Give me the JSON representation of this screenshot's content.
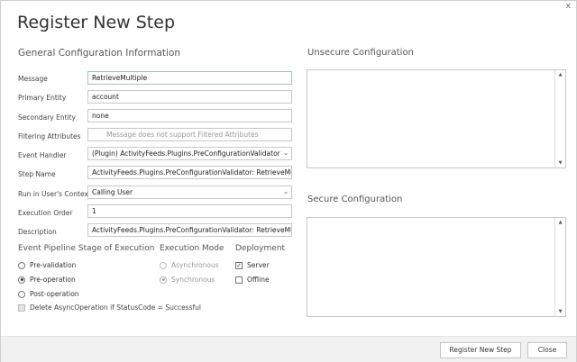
{
  "dialog": {
    "title": "Register New Step",
    "close_glyph": "x"
  },
  "general": {
    "heading": "General Configuration Information",
    "fields": [
      {
        "label": "Message",
        "value": "RetrieveMultiple",
        "placeholder": ""
      },
      {
        "label": "Primary Entity",
        "value": "account",
        "placeholder": ""
      },
      {
        "label": "Secondary Entity",
        "value": "none",
        "placeholder": ""
      },
      {
        "label": "Filtering Attributes",
        "value": "",
        "placeholder": "Message does not support Filtered Attributes"
      },
      {
        "label": "Event Handler",
        "value": "(Plugin) ActivityFeeds.Plugins.PreConfigurationValidator",
        "placeholder": ""
      },
      {
        "label": "Step Name",
        "value": "ActivityFeeds.Plugins.PreConfigurationValidator: RetrieveMultiple of account",
        "placeholder": ""
      },
      {
        "label": "Run in User's Context",
        "value": "Calling User",
        "placeholder": ""
      },
      {
        "label": "Execution Order",
        "value": "1",
        "placeholder": ""
      },
      {
        "label": "Description",
        "value": "ActivityFeeds.Plugins.PreConfigurationValidator: RetrieveMultiple of account",
        "placeholder": ""
      }
    ]
  },
  "pipeline": {
    "heading": "Event Pipeline Stage of Execution",
    "options": [
      "Pre-validation",
      "Pre-operation",
      "Post-operation"
    ],
    "selected": "Pre-operation"
  },
  "execution_mode": {
    "heading": "Execution Mode",
    "options": [
      "Asynchronous",
      "Synchronous"
    ],
    "selected": "Synchronous"
  },
  "deployment": {
    "heading": "Deployment",
    "server_label": "Server",
    "server_checked": true,
    "offline_label": "Offline",
    "offline_checked": false
  },
  "delete_async": {
    "label": "Delete AsyncOperation if StatusCode = Successful",
    "checked": false
  },
  "unsecure": {
    "heading": "Unsecure  Configuration",
    "value": ""
  },
  "secure": {
    "heading": "Secure  Configuration",
    "value": ""
  },
  "icons": {
    "select_arrow": "chevron-down-icon",
    "scroll_up": "scroll-up-arrow-icon",
    "scroll_down": "scroll-down-arrow-icon",
    "check": "check-icon"
  },
  "footer": {
    "register_label": "Register New Step",
    "close_label": "Close"
  },
  "colors": {
    "accent_border": "#9bc7c1",
    "footer_bg": "#f1f1f1"
  }
}
